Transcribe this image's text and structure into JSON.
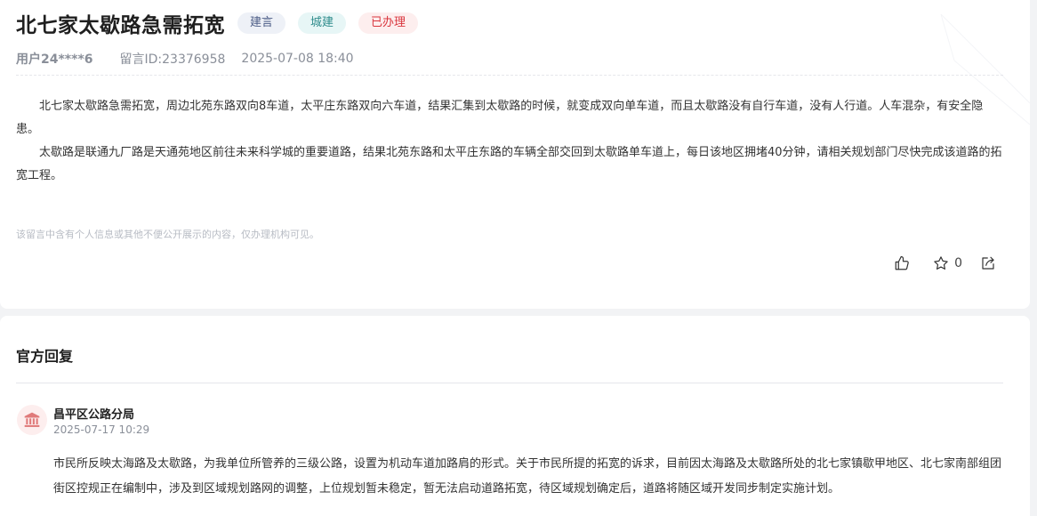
{
  "post": {
    "title": "北七家太歇路急需拓宽",
    "tags": [
      {
        "label": "建言",
        "color": "#4c5d86"
      },
      {
        "label": "城建",
        "color": "#2f8c8c"
      },
      {
        "label": "已办理",
        "color": "#d9363e"
      }
    ],
    "user": "用户24****6",
    "message_id": "留言ID:23376958",
    "datetime": "2025-07-08 18:40",
    "paragraphs": [
      "北七家太歇路急需拓宽，周边北苑东路双向8车道，太平庄东路双向六车道，结果汇集到太歇路的时候，就变成双向单车道，而且太歇路没有自行车道，没有人行道。人车混杂，有安全隐患。",
      "太歇路是联通九厂路是天通苑地区前往未来科学城的重要道路，结果北苑东路和太平庄东路的车辆全部交回到太歇路单车道上，每日该地区拥堵40分钟，请相关规划部门尽快完成该道路的拓宽工程。"
    ],
    "privacy_note": "该留言中含有个人信息或其他不便公开展示的内容，仅办理机构可见。",
    "actions": {
      "like_icon": "thumbs-up-icon",
      "favorite_icon": "star-icon",
      "favorite_count": "0",
      "share_icon": "share-icon"
    }
  },
  "reply": {
    "section_title": "官方回复",
    "org_icon": "government-building-icon",
    "org_name": "昌平区公路分局",
    "datetime": "2025-07-17 10:29",
    "content": "市民所反映太海路及太歇路，为我单位所管养的三级公路，设置为机动车道加路肩的形式。关于市民所提的拓宽的诉求，目前因太海路及太歇路所处的北七家镇歇甲地区、北七家南部组团街区控规正在编制中，涉及到区域规划路网的调整，上位规划暂未稳定，暂无法启动道路拓宽，待区域规划确定后，道路将随区域开发同步制定实施计划。"
  },
  "colors": {
    "accent_red": "#d9363e",
    "background": "#f2f3f5",
    "card": "#ffffff"
  }
}
